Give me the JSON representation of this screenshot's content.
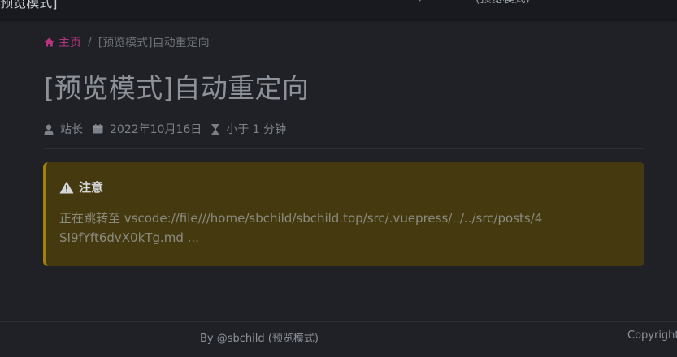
{
  "topbar": {
    "site_title": "[预览模式]",
    "nav_fragment": "/",
    "nav_fragment_2": "(预览模式)"
  },
  "breadcrumb": {
    "home_label": "主页",
    "separator": "/",
    "current": "[预览模式]自动重定向"
  },
  "page": {
    "title": "[预览模式]自动重定向"
  },
  "meta": {
    "author": "站长",
    "date": "2022年10月16日",
    "reading_time": "小于 1 分钟"
  },
  "alert": {
    "title": "注意",
    "text": "正在跳转至 vscode://file///home/sbchild/sbchild.top/src/.vuepress/../../src/posts/4SI9fYft6dvX0kTg.md ...",
    "icon": "warning-icon",
    "accent_color": "#a1800e",
    "background_color": "#453a0f"
  },
  "footer": {
    "byline": "By @sbchild (预览模式)",
    "copyright": "Copyright"
  },
  "colors": {
    "background": "#1f2126",
    "brand": "#b8337f"
  }
}
